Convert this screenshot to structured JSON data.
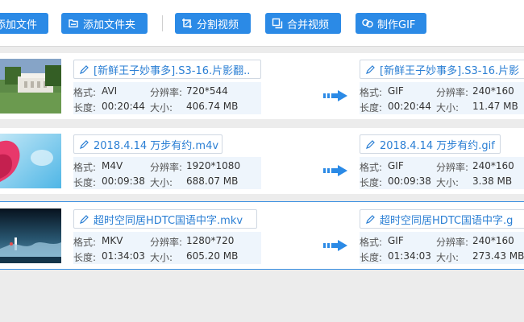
{
  "toolbar": {
    "add_file": "添加文件",
    "add_folder": "添加文件夹",
    "split_video": "分割视频",
    "merge_video": "合并视频",
    "make_gif": "制作GIF"
  },
  "labels": {
    "format": "格式:",
    "resolution": "分辨率:",
    "duration": "长度:",
    "size": "大小:"
  },
  "rows": [
    {
      "source": {
        "name": "[新鲜王子妙事多].S3-16.片影翻..",
        "format": "AVI",
        "resolution": "720*544",
        "duration": "00:20:44",
        "size": "406.74 MB"
      },
      "output": {
        "name": "[新鲜王子妙事多].S3-16.片影",
        "format": "GIF",
        "resolution": "240*160",
        "duration": "00:20:44",
        "size": "11.47 MB"
      }
    },
    {
      "source": {
        "name": "2018.4.14 万步有约.m4v",
        "format": "M4V",
        "resolution": "1920*1080",
        "duration": "00:09:38",
        "size": "688.07 MB"
      },
      "output": {
        "name": "2018.4.14 万步有约.gif",
        "format": "GIF",
        "resolution": "240*160",
        "duration": "00:09:38",
        "size": "3.38 MB"
      }
    },
    {
      "source": {
        "name": "超时空同居HDTC国语中字.mkv",
        "format": "MKV",
        "resolution": "1280*720",
        "duration": "01:34:03",
        "size": "605.20 MB"
      },
      "output": {
        "name": "超时空同居HDTC国语中字.g",
        "format": "GIF",
        "resolution": "240*160",
        "duration": "01:34:03",
        "size": "273.43 MB"
      }
    }
  ],
  "colors": {
    "accent": "#2b8ae6",
    "link": "#2b7fd4",
    "info_bg": "#eef5fc"
  },
  "icons": [
    "add-file-icon",
    "folder-icon",
    "split-icon",
    "merge-icon",
    "gif-icon",
    "pencil-icon",
    "convert-arrow-icon"
  ]
}
